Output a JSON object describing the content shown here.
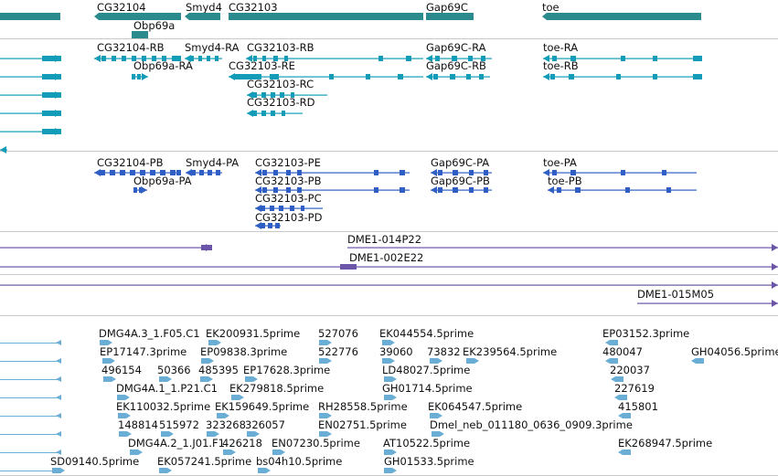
{
  "colors": {
    "gene": "#2a8a8c",
    "rna": "#139cb8",
    "protein": "#2f5fc4",
    "clone": "#6a55a8",
    "est": "#6aaed6",
    "separator": "#c9c9c9",
    "label": "#111111"
  },
  "tracks": {
    "genes": {
      "labels": [
        "CG32104",
        "Obp69a",
        "Smyd4",
        "CG32103",
        "Gap69C",
        "toe"
      ]
    },
    "transcripts": {
      "labels": [
        "CG32104-RB",
        "Smyd4-RA",
        "CG32103-RB",
        "Gap69C-RA",
        "toe-RA",
        "Obp69a-RA",
        "CG32103-RE",
        "Gap69C-RB",
        "toe-RB",
        "CG32103-RC",
        "CG32103-RD"
      ]
    },
    "proteins": {
      "labels": [
        "CG32104-PB",
        "Smyd4-PA",
        "CG32103-PE",
        "Gap69C-PA",
        "toe-PA",
        "Obp69a-PA",
        "CG32103-PB",
        "Gap69C-PB",
        "toe-PB",
        "CG32103-PC",
        "CG32103-PD"
      ]
    },
    "clones": {
      "labels": [
        "DME1-014P22",
        "DME1-002E22",
        "DME1-015M05"
      ]
    },
    "ests": {
      "labels": [
        "DMG4A.3_1.F05.C1",
        "EK200931.5prime",
        "527076",
        "EK044554.5prime",
        "EP03152.3prime",
        "EP17147.3prime",
        "EP09838.3prime",
        "522776",
        "39060",
        "73832",
        "EK239564.5prime",
        "480047",
        "GH04056.5prime",
        "496154",
        "50366",
        "485395",
        "EP17628.3prime",
        "LD48027.5prime",
        "220037",
        "DMG4A.1_1.P21.C1",
        "EK279818.5prime",
        "GH01714.5prime",
        "227619",
        "EK110032.5prime",
        "EK159649.5prime",
        "RH28558.5prime",
        "EK064547.5prime",
        "415801",
        "148814",
        "515972",
        "323268",
        "326057",
        "EN02751.5prime",
        "Dmel_neb_011180_0636_0909.3prime",
        "DMG4A.2_1.J01.F1",
        "426218",
        "EN07230.5prime",
        "AT10522.5prime",
        "EK268947.5prime",
        "SD09140.5prime",
        "EK057241.5prime",
        "bs04h10.5prime",
        "GH01533.5prime"
      ]
    }
  }
}
